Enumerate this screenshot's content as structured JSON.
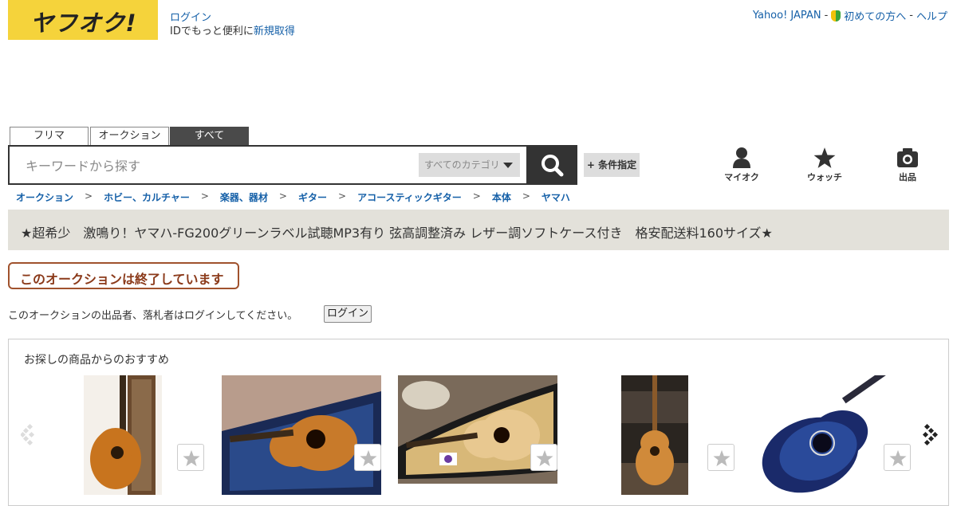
{
  "header": {
    "logo_text": "ヤフオク!",
    "login_link": "ログイン",
    "login_sub_text": "IDでもっと便利に",
    "signup_link": "新規取得",
    "top_links": {
      "yahoo": "Yahoo! JAPAN",
      "sep": "-",
      "beginner": "初めての方へ",
      "help": "ヘルプ"
    }
  },
  "search": {
    "tabs": [
      "フリマ",
      "オークション",
      "すべて"
    ],
    "active_tab": "すべて",
    "placeholder": "キーワードから探す",
    "category": "すべてのカテゴリ",
    "condition_button": "+ 条件指定"
  },
  "nav": {
    "my_auction": "マイオク",
    "watch": "ウォッチ",
    "sell": "出品"
  },
  "breadcrumb": [
    "オークション",
    "ホビー、カルチャー",
    "楽器、器材",
    "ギター",
    "アコースティックギター",
    "本体",
    "ヤマハ"
  ],
  "breadcrumb_sep": ">",
  "item": {
    "title": "★超希少　激鳴り！ヤマハ-FG200グリーンラベル試聴MP3有り 弦高調整済み レザー調ソフトケース付き　格安配送料160サイズ★",
    "ended_label": "このオークションは終了しています",
    "notice": "このオークションの出品者、落札者はログインしてください。",
    "notice_button": "ログイン"
  },
  "recommend": {
    "title": "お探しの商品からのおすすめ",
    "items": [
      {
        "image": "acoustic-guitar-leaning-with-case"
      },
      {
        "image": "acoustic-guitar-in-blue-case"
      },
      {
        "image": "morris-guitar-in-case"
      },
      {
        "image": "acoustic-guitar-on-stand"
      },
      {
        "image": "blue-cutaway-acoustic-guitar"
      }
    ]
  },
  "colors": {
    "logo_yellow": "#f5d33b",
    "link_blue": "#1560a8",
    "title_bar_bg": "#e3e1da",
    "ended_border": "#a0522d"
  }
}
